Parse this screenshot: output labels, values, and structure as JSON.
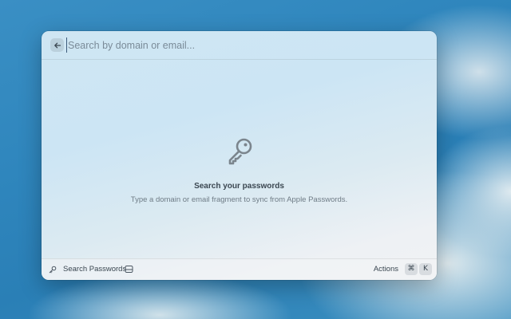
{
  "search": {
    "placeholder": "Search by domain or email...",
    "value": ""
  },
  "empty_state": {
    "icon": "key-icon",
    "title": "Search your passwords",
    "subtitle": "Type a domain or email fragment to sync from Apple Passwords."
  },
  "footer": {
    "command_icon": "key-icon",
    "command_label": "Search Passwords",
    "secondary_icon": "drive-icon",
    "actions_label": "Actions",
    "shortcut_keys": [
      "⌘",
      "K"
    ]
  },
  "colors": {
    "wallpaper_blue": "#2f86bd",
    "window_tint": "#cfe6f3",
    "text_primary": "#3a4650",
    "text_secondary": "#6f7c86"
  }
}
